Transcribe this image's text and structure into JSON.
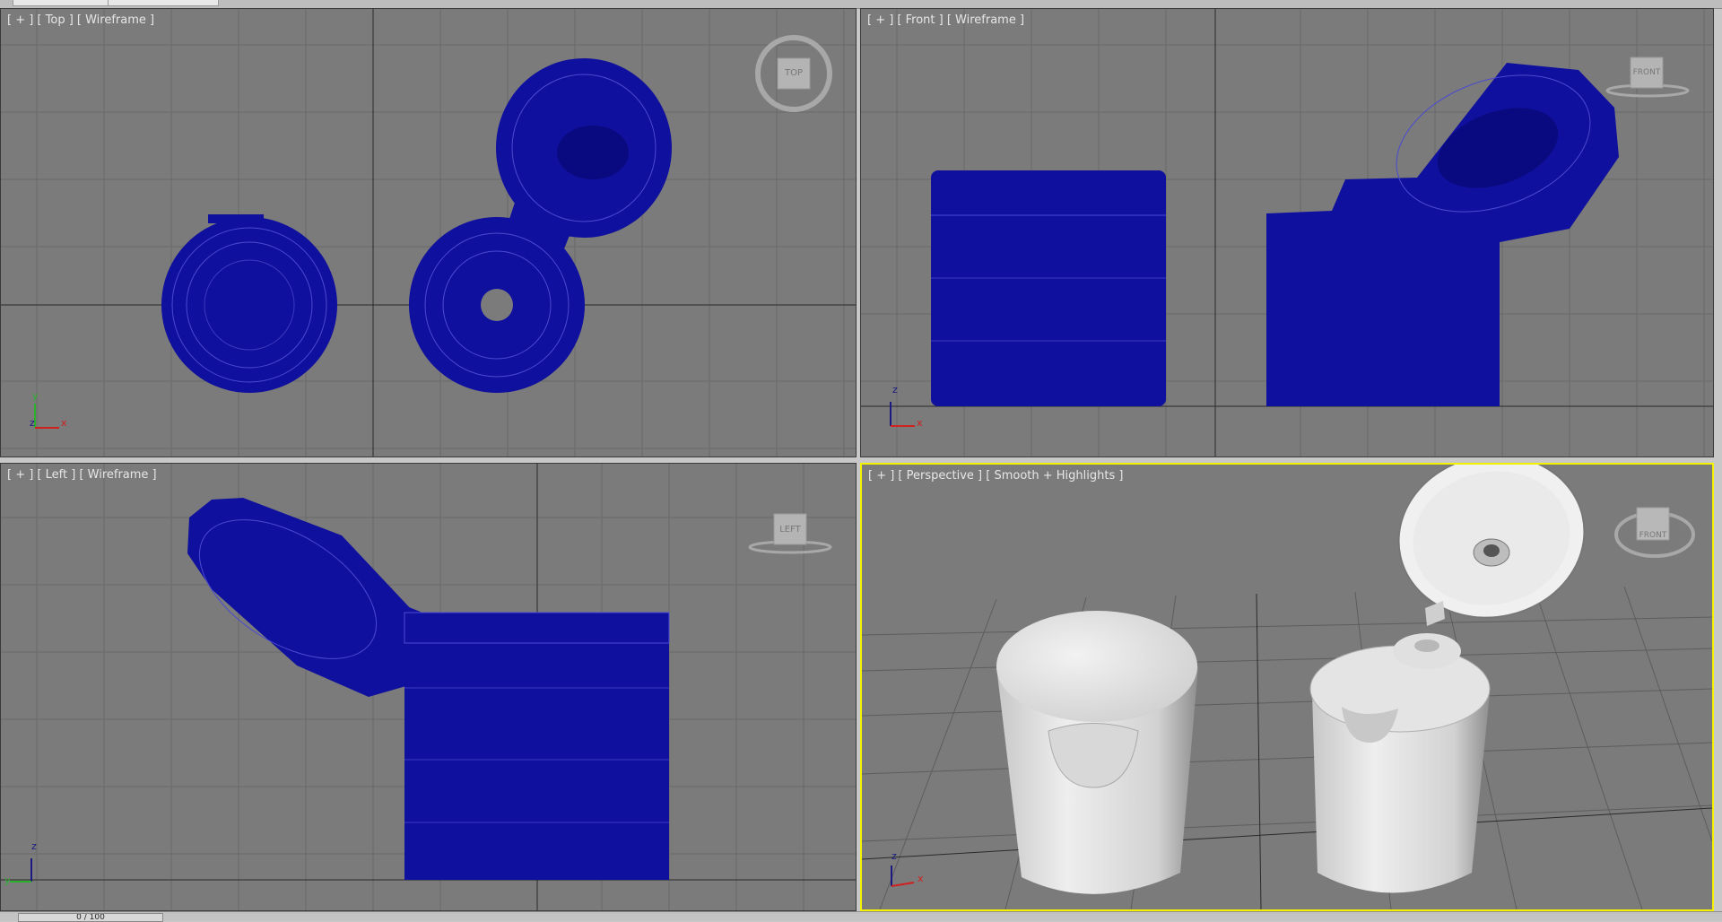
{
  "tabs": [
    "",
    ""
  ],
  "viewports": {
    "top": {
      "label": "[ + ] [ Top ] [ Wireframe ]",
      "cube": "TOP"
    },
    "front": {
      "label": "[ + ] [ Front ] [ Wireframe ]",
      "cube": "FRONT"
    },
    "left": {
      "label": "[ + ] [ Left ] [ Wireframe ]",
      "cube": "LEFT"
    },
    "perspective": {
      "label": "[ + ] [ Perspective ] [ Smooth + Highlights ]",
      "cube": "FRONT"
    }
  },
  "axes": {
    "x": "x",
    "y": "y",
    "z": "z"
  },
  "status": {
    "frame": "0 / 100"
  },
  "colors": {
    "viewport_bg": "#7b7b7b",
    "grid": "#6a6a6a",
    "wire": "#1010a0",
    "active_border": "#f4f200"
  }
}
